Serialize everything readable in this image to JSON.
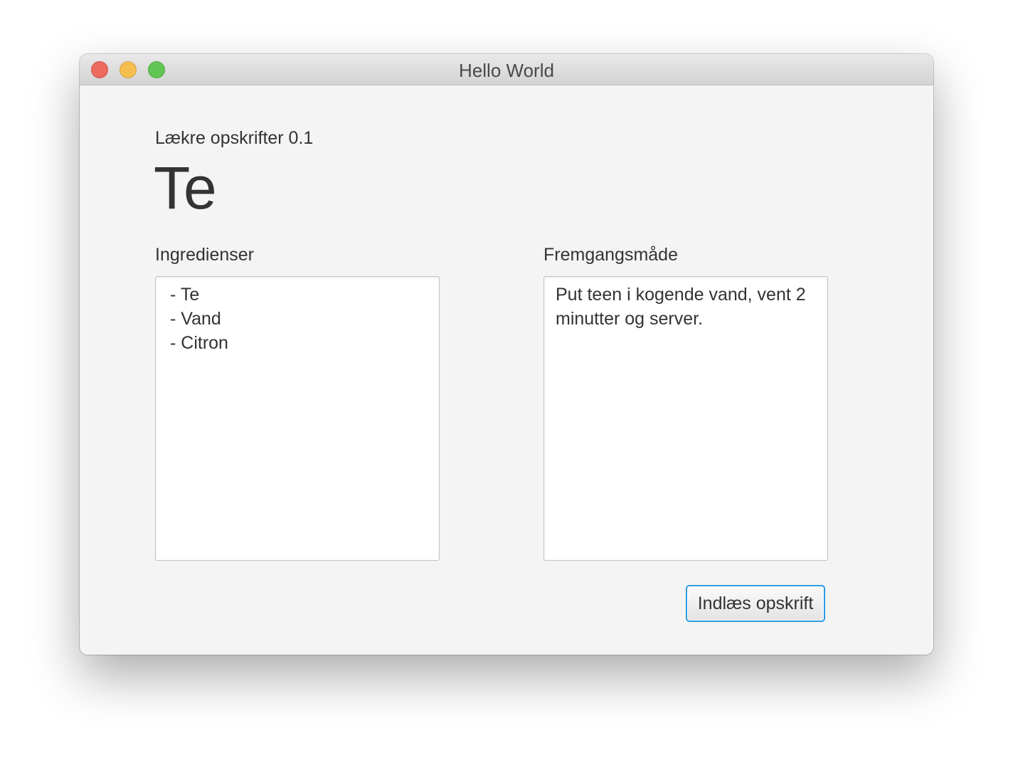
{
  "window": {
    "title": "Hello World"
  },
  "header": {
    "app_name": "Lækre opskrifter 0.1",
    "recipe_title": "Te"
  },
  "ingredients": {
    "label": "Ingredienser",
    "text": "- Te\n- Vand\n- Citron"
  },
  "method": {
    "label": "Fremgangsmåde",
    "text": "Put teen i kogende vand, vent 2 minutter og server."
  },
  "actions": {
    "load_label": "Indlæs opskrift"
  },
  "colors": {
    "close": "#ed6a5e",
    "minimize": "#f5bf4f",
    "zoom": "#62c655",
    "focus_ring": "#2b9be0"
  }
}
